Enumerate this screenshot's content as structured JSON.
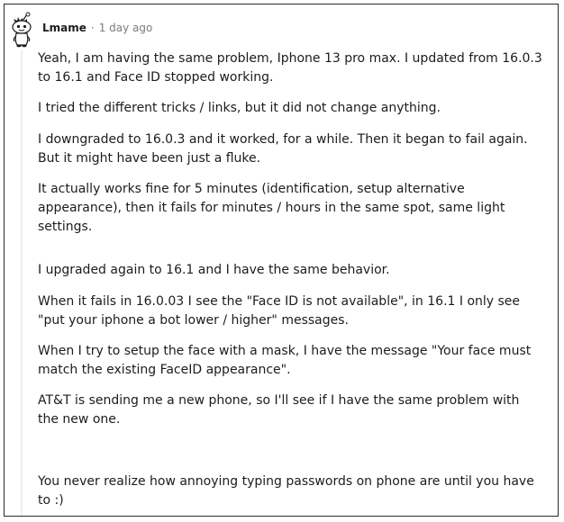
{
  "comment": {
    "username": "Lmame",
    "separator": "·",
    "timestamp": "1 day ago",
    "avatar_icon": "snoo-avatar-icon",
    "paragraphs": [
      "Yeah, I am having the same problem, Iphone 13 pro max. I updated from 16.0.3 to 16.1 and Face ID stopped working.",
      "I tried the different tricks / links, but it did not change anything.",
      "I downgraded to 16.0.3 and it worked, for a while. Then it began to fail again. But it might have been just a fluke.",
      "It actually works fine for 5 minutes (identification, setup alternative appearance), then it fails for minutes / hours in the same spot, same light settings.",
      "I upgraded again to 16.1 and I have the same behavior.",
      "When it fails in 16.0.03 I see the \"Face ID is not available\", in 16.1 I only see \"put your iphone a bot lower / higher\" messages.",
      "When I try to setup the face with a mask, I have the message \"Your face must match the existing FaceID appearance\".",
      "AT&T is sending me a new phone, so I'll see if I have the same problem with the new one.",
      "You never realize how annoying typing passwords on phone are until you have to :)"
    ]
  }
}
